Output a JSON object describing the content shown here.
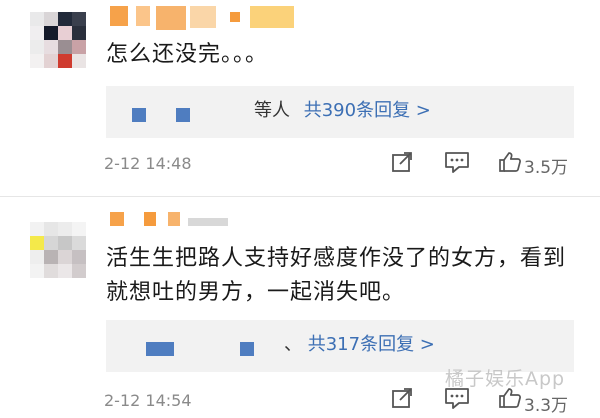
{
  "comments": [
    {
      "text": "怎么还没完。。。",
      "reply_prefix": "等人",
      "reply_link": "共390条回复 >",
      "time": "2-12 14:48",
      "likes": "3.5万"
    },
    {
      "text": "活生生把路人支持好感度作没了的女方，看到就想吐的男方，一起消失吧。",
      "reply_prefix": "、",
      "reply_link": "共317条回复 >",
      "time": "2-12 14:54",
      "likes": "3.3万"
    }
  ],
  "watermark": "橘子娱乐App",
  "icons": {
    "share": "share-icon",
    "comment": "comment-icon",
    "like": "like-icon"
  },
  "colors": {
    "link": "#3c6fb4",
    "meta": "#8a8a8a",
    "reply_bg": "#f2f2f2",
    "redaction_orange": "#f6a24a",
    "redaction_blue": "#4f7dc0"
  }
}
